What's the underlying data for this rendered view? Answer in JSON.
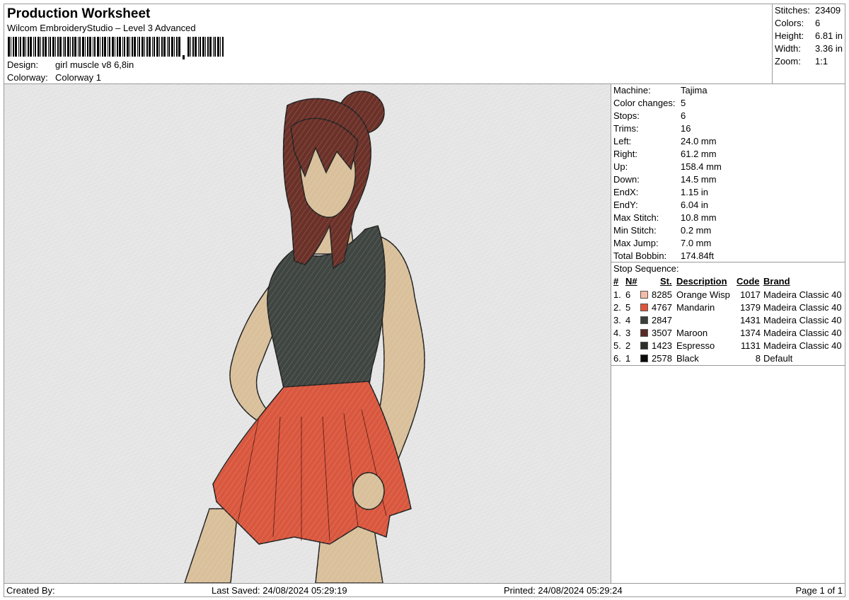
{
  "header": {
    "title": "Production Worksheet",
    "subtitle": "Wilcom EmbroideryStudio – Level 3 Advanced",
    "design_label": "Design:",
    "design_value": "girl muscle v8 6,8in",
    "colorway_label": "Colorway:",
    "colorway_value": "Colorway 1"
  },
  "stats": [
    {
      "label": "Stitches:",
      "value": "23409"
    },
    {
      "label": "Colors:",
      "value": "6"
    },
    {
      "label": "Height:",
      "value": "6.81 in"
    },
    {
      "label": "Width:",
      "value": "3.36 in"
    },
    {
      "label": "Zoom:",
      "value": "1:1"
    }
  ],
  "machine_info": [
    {
      "label": "Machine:",
      "value": "Tajima"
    },
    {
      "label": "Color changes:",
      "value": "5"
    },
    {
      "label": "Stops:",
      "value": "6"
    },
    {
      "label": "Trims:",
      "value": "16"
    },
    {
      "label": "Left:",
      "value": "24.0 mm"
    },
    {
      "label": "Right:",
      "value": "61.2 mm"
    },
    {
      "label": "Up:",
      "value": "158.4 mm"
    },
    {
      "label": "Down:",
      "value": "14.5 mm"
    },
    {
      "label": "EndX:",
      "value": "1.15 in"
    },
    {
      "label": "EndY:",
      "value": "6.04 in"
    },
    {
      "label": "Max Stitch:",
      "value": "10.8 mm"
    },
    {
      "label": "Min Stitch:",
      "value": "0.2 mm"
    },
    {
      "label": "Max Jump:",
      "value": "7.0 mm"
    },
    {
      "label": "Total Bobbin:",
      "value": "174.84ft"
    }
  ],
  "stop_sequence": {
    "title": "Stop Sequence:",
    "headers": {
      "num": "#",
      "n": "N#",
      "st": "St.",
      "desc": "Description",
      "code": "Code",
      "brand": "Brand"
    },
    "rows": [
      {
        "num": "1.",
        "n": "6",
        "color": "#f4bca8",
        "st": "8285",
        "desc": "Orange Wisp",
        "code": "1017",
        "brand": "Madeira Classic 40"
      },
      {
        "num": "2.",
        "n": "5",
        "color": "#e0553a",
        "st": "4767",
        "desc": "Mandarin",
        "code": "1379",
        "brand": "Madeira Classic 40"
      },
      {
        "num": "3.",
        "n": "4",
        "color": "#3a3f3a",
        "st": "2847",
        "desc": "",
        "code": "1431",
        "brand": "Madeira Classic 40"
      },
      {
        "num": "4.",
        "n": "3",
        "color": "#5a2a24",
        "st": "3507",
        "desc": "Maroon",
        "code": "1374",
        "brand": "Madeira Classic 40"
      },
      {
        "num": "5.",
        "n": "2",
        "color": "#2e2e28",
        "st": "1423",
        "desc": "Espresso",
        "code": "1131",
        "brand": "Madeira Classic 40"
      },
      {
        "num": "6.",
        "n": "1",
        "color": "#0a0a0a",
        "st": "2578",
        "desc": "Black",
        "code": "8",
        "brand": "Default"
      }
    ]
  },
  "footer": {
    "created_by": "Created By:",
    "last_saved": "Last Saved: 24/08/2024 05:29:19",
    "printed": "Printed: 24/08/2024 05:29:24",
    "page": "Page 1 of 1"
  },
  "icons": {
    "barcode": "barcode-icon"
  }
}
